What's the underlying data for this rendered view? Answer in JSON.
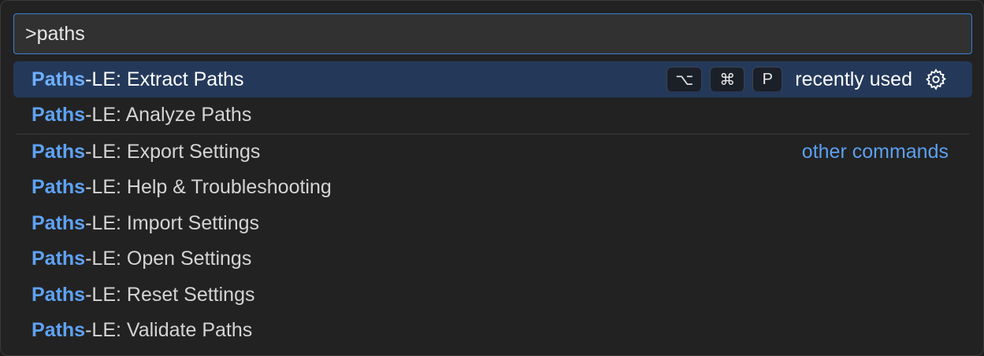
{
  "search": {
    "value": ">paths"
  },
  "items": [
    {
      "prefix": "Paths",
      "rest": "-LE: Extract Paths",
      "selected": true
    },
    {
      "prefix": "Paths",
      "rest": "-LE: Analyze Paths"
    },
    {
      "prefix": "Paths",
      "rest": "-LE: Export Settings",
      "group": "other commands"
    },
    {
      "prefix": "Paths",
      "rest": "-LE: Help & Troubleshooting"
    },
    {
      "prefix": "Paths",
      "rest": "-LE: Import Settings"
    },
    {
      "prefix": "Paths",
      "rest": "-LE: Open Settings"
    },
    {
      "prefix": "Paths",
      "rest": "-LE: Reset Settings"
    },
    {
      "prefix": "Paths",
      "rest": "-LE: Validate Paths"
    }
  ],
  "selected_meta": {
    "keys": [
      "⌥",
      "⌘",
      "P"
    ],
    "recently_used": "recently used",
    "gear_icon": "gear-icon"
  },
  "colors": {
    "accent": "#3b7fd6",
    "highlight": "#5ea2f5",
    "selected_bg": "#24395a"
  }
}
